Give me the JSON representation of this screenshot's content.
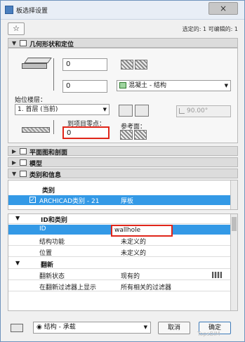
{
  "window": {
    "title": "板选择设置",
    "close_label": "×"
  },
  "toolbar": {
    "favorites_label": "☆",
    "selection_info": "选定的: 1 可编辑的: 1"
  },
  "geometry": {
    "section_label": "几何形状和定位",
    "thickness_value": "0",
    "offset_value": "0",
    "home_story_label": "始位楼层：",
    "home_story_value": "1. 首层 (当前)",
    "to_project_zero_label": "到项目零点：",
    "to_project_zero_value": "0",
    "material_value": "混凝土 - 结构",
    "angle_value": "90.00°",
    "reference_plane_label": "参考面："
  },
  "sections": {
    "floor_plan": "平面图和剖面",
    "model": "模型",
    "classification": "类别和信息"
  },
  "classification_table": {
    "category_header": "类别",
    "category_row": {
      "name": "ARCHICAD类别 - 21",
      "value": "厚板"
    },
    "id_group_header": "ID和类别",
    "rows": [
      {
        "name": "ID",
        "value": "wallhole"
      },
      {
        "name": "结构功能",
        "value": "未定义的"
      },
      {
        "name": "位置",
        "value": "未定义的"
      }
    ],
    "renovation_header": "翻新",
    "renovation_rows": [
      {
        "name": "翻新状态",
        "value": "现有的"
      },
      {
        "name": "在翻新过滤器上显示",
        "value": "所有相关的过滤器"
      }
    ]
  },
  "footer": {
    "layer_value": "结构 - 承载",
    "cancel_label": "取消",
    "ok_label": "确定",
    "watermark": "TopsBIM"
  }
}
